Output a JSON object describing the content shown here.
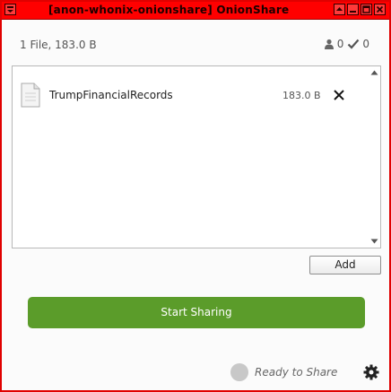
{
  "window": {
    "title": "[anon-whonix-onionshare] OnionShare",
    "titlebar_color": "#ff0000"
  },
  "summary": {
    "text": "1 File, 183.0 B",
    "downloads_count": "0",
    "completed_count": "0"
  },
  "files": [
    {
      "name": "TrumpFinancialRecords",
      "size": "183.0 B",
      "icon": "file-icon",
      "remove_icon": "close-icon"
    }
  ],
  "buttons": {
    "add_label": "Add",
    "start_label": "Start Sharing",
    "start_color": "#5b9c2a"
  },
  "status": {
    "text": "Ready to Share",
    "indicator_color": "#c8c8c8",
    "settings_icon": "gear-icon"
  }
}
